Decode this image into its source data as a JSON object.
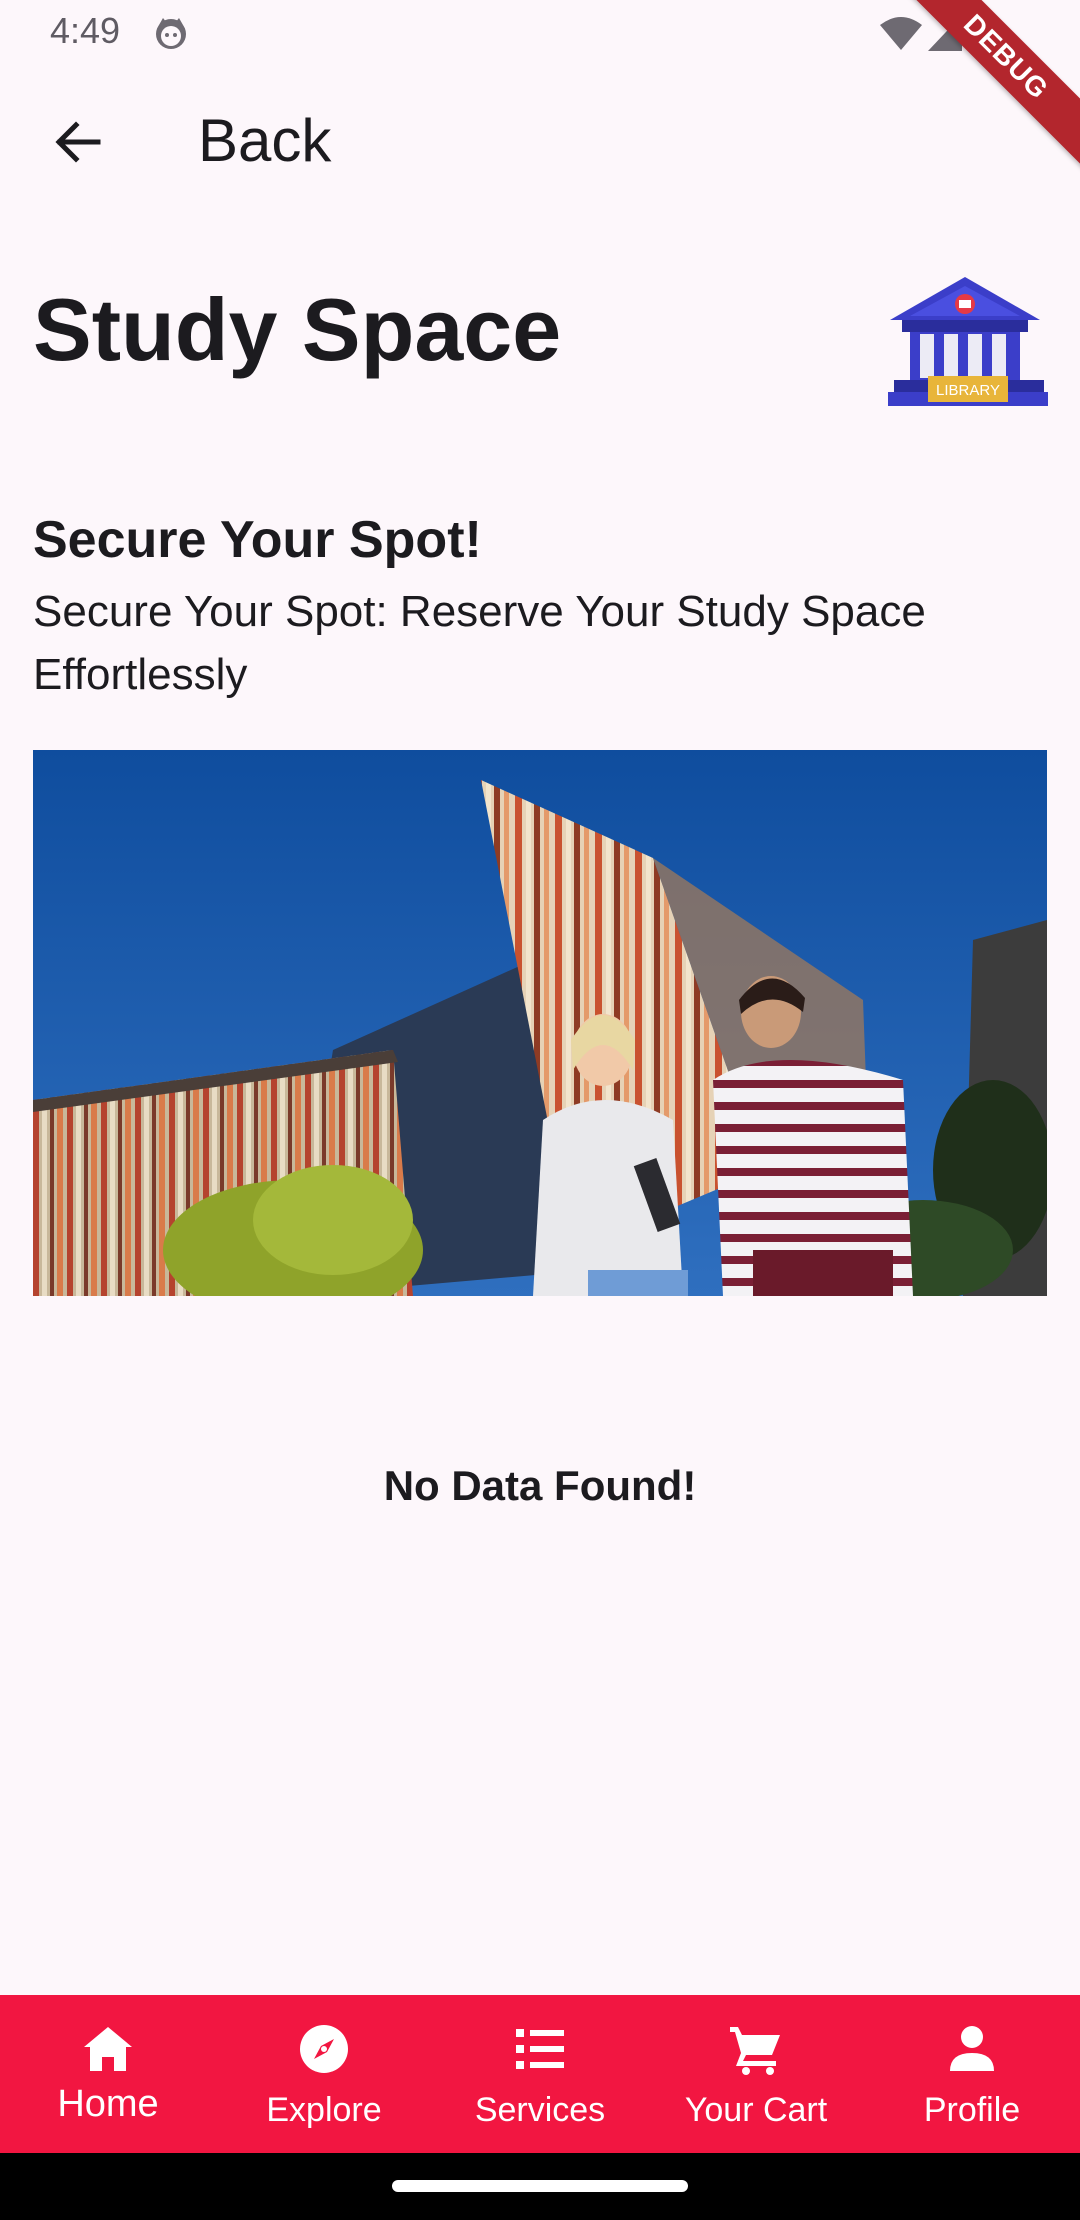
{
  "status_bar": {
    "time": "4:49",
    "debug_label": "DEBUG"
  },
  "app_bar": {
    "back_label": "Back"
  },
  "page": {
    "title": "Study Space",
    "library_icon_text": "LIBRARY"
  },
  "section": {
    "heading": "Secure Your Spot!",
    "subtitle": "Secure Your Spot: Reserve Your Study Space Effortlessly"
  },
  "empty_state": {
    "message": "No Data Found!"
  },
  "bottom_nav": {
    "items": [
      {
        "label": "Home",
        "icon": "home-icon",
        "active": true
      },
      {
        "label": "Explore",
        "icon": "compass-icon",
        "active": false
      },
      {
        "label": "Services",
        "icon": "list-icon",
        "active": false
      },
      {
        "label": "Your Cart",
        "icon": "cart-icon",
        "active": false
      },
      {
        "label": "Profile",
        "icon": "person-icon",
        "active": false
      }
    ]
  },
  "colors": {
    "background": "#fdf7fb",
    "nav_accent": "#f21641",
    "debug_banner": "#b3262d",
    "text": "#1c1b1f"
  }
}
